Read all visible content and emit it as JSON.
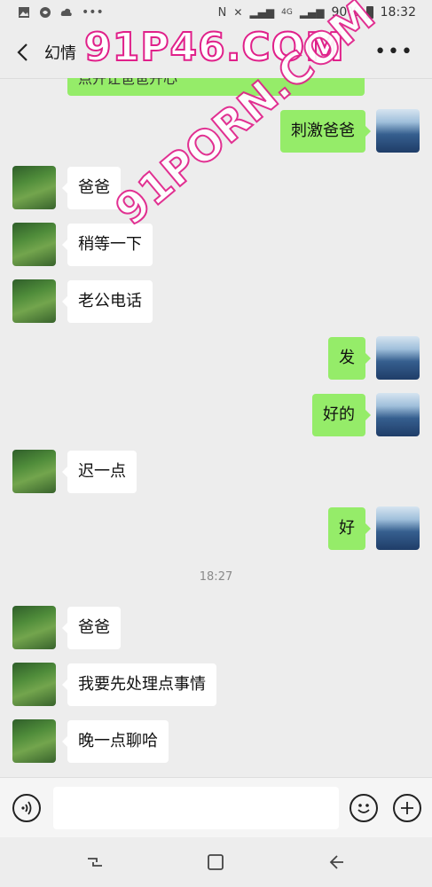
{
  "status_bar": {
    "battery": "90%",
    "time": "18:32",
    "network": "4G"
  },
  "header": {
    "title": "幻情"
  },
  "watermarks": {
    "top": "91P46.COM",
    "diagonal": "91PORN.COM"
  },
  "partial_message": "点开让爸爸开心",
  "messages": [
    {
      "side": "sent",
      "text": "刺激爸爸"
    },
    {
      "side": "recv",
      "text": "爸爸"
    },
    {
      "side": "recv",
      "text": "稍等一下"
    },
    {
      "side": "recv",
      "text": "老公电话"
    },
    {
      "side": "sent",
      "text": "发"
    },
    {
      "side": "sent",
      "text": "好的"
    },
    {
      "side": "recv",
      "text": "迟一点"
    },
    {
      "side": "sent",
      "text": "好"
    },
    {
      "side": "recv",
      "text": "爸爸"
    },
    {
      "side": "recv",
      "text": "我要先处理点事情"
    },
    {
      "side": "recv",
      "text": "晚一点聊哈"
    }
  ],
  "timestamp": "18:27",
  "input": {
    "value": "",
    "placeholder": ""
  },
  "icons": {
    "voice": "voice-icon",
    "emoji": "emoji-icon",
    "plus": "plus-icon",
    "back": "back-icon",
    "more": "more-icon"
  },
  "colors": {
    "sent_bubble": "#95ec69",
    "recv_bubble": "#ffffff",
    "background": "#ededed"
  }
}
